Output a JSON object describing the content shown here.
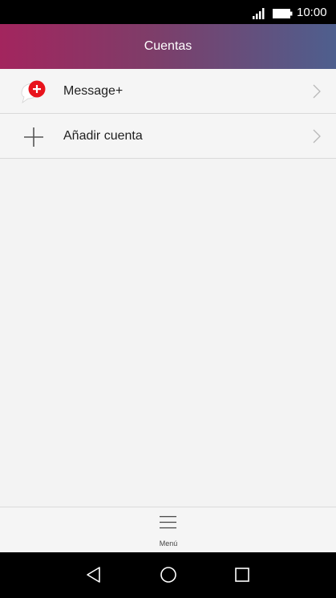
{
  "status_bar": {
    "time": "10:00",
    "signal_icon": "signal-bars-icon",
    "battery_icon": "battery-icon"
  },
  "header": {
    "title": "Cuentas"
  },
  "accounts": [
    {
      "label": "Message+",
      "icon": "message-plus-icon"
    },
    {
      "label": "Añadir cuenta",
      "icon": "plus-icon"
    }
  ],
  "bottom_bar": {
    "menu_label": "Menú",
    "menu_icon": "hamburger-icon"
  },
  "nav_bar": {
    "back_icon": "back-triangle-icon",
    "home_icon": "home-circle-icon",
    "recents_icon": "recents-square-icon"
  },
  "colors": {
    "header_gradient_start": "#a3255e",
    "header_gradient_end": "#4e5f8e",
    "message_plus_red": "#e8131c",
    "background": "#f3f3f3"
  }
}
